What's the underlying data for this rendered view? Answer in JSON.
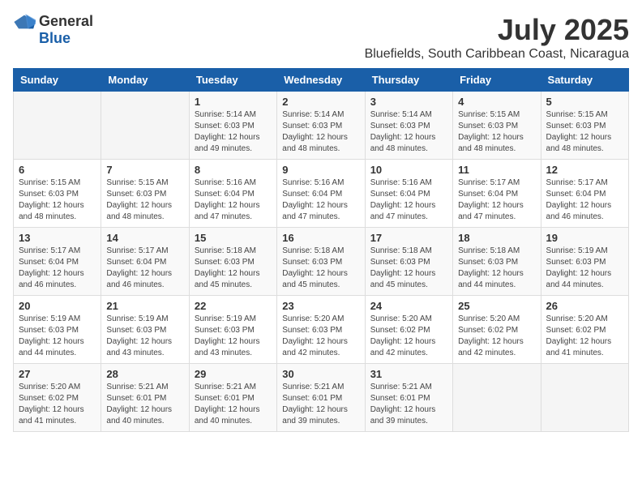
{
  "logo": {
    "general": "General",
    "blue": "Blue"
  },
  "title": "July 2025",
  "location": "Bluefields, South Caribbean Coast, Nicaragua",
  "days_header": [
    "Sunday",
    "Monday",
    "Tuesday",
    "Wednesday",
    "Thursday",
    "Friday",
    "Saturday"
  ],
  "weeks": [
    [
      {
        "day": "",
        "info": ""
      },
      {
        "day": "",
        "info": ""
      },
      {
        "day": "1",
        "info": "Sunrise: 5:14 AM\nSunset: 6:03 PM\nDaylight: 12 hours and 49 minutes."
      },
      {
        "day": "2",
        "info": "Sunrise: 5:14 AM\nSunset: 6:03 PM\nDaylight: 12 hours and 48 minutes."
      },
      {
        "day": "3",
        "info": "Sunrise: 5:14 AM\nSunset: 6:03 PM\nDaylight: 12 hours and 48 minutes."
      },
      {
        "day": "4",
        "info": "Sunrise: 5:15 AM\nSunset: 6:03 PM\nDaylight: 12 hours and 48 minutes."
      },
      {
        "day": "5",
        "info": "Sunrise: 5:15 AM\nSunset: 6:03 PM\nDaylight: 12 hours and 48 minutes."
      }
    ],
    [
      {
        "day": "6",
        "info": "Sunrise: 5:15 AM\nSunset: 6:03 PM\nDaylight: 12 hours and 48 minutes."
      },
      {
        "day": "7",
        "info": "Sunrise: 5:15 AM\nSunset: 6:03 PM\nDaylight: 12 hours and 48 minutes."
      },
      {
        "day": "8",
        "info": "Sunrise: 5:16 AM\nSunset: 6:04 PM\nDaylight: 12 hours and 47 minutes."
      },
      {
        "day": "9",
        "info": "Sunrise: 5:16 AM\nSunset: 6:04 PM\nDaylight: 12 hours and 47 minutes."
      },
      {
        "day": "10",
        "info": "Sunrise: 5:16 AM\nSunset: 6:04 PM\nDaylight: 12 hours and 47 minutes."
      },
      {
        "day": "11",
        "info": "Sunrise: 5:17 AM\nSunset: 6:04 PM\nDaylight: 12 hours and 47 minutes."
      },
      {
        "day": "12",
        "info": "Sunrise: 5:17 AM\nSunset: 6:04 PM\nDaylight: 12 hours and 46 minutes."
      }
    ],
    [
      {
        "day": "13",
        "info": "Sunrise: 5:17 AM\nSunset: 6:04 PM\nDaylight: 12 hours and 46 minutes."
      },
      {
        "day": "14",
        "info": "Sunrise: 5:17 AM\nSunset: 6:04 PM\nDaylight: 12 hours and 46 minutes."
      },
      {
        "day": "15",
        "info": "Sunrise: 5:18 AM\nSunset: 6:03 PM\nDaylight: 12 hours and 45 minutes."
      },
      {
        "day": "16",
        "info": "Sunrise: 5:18 AM\nSunset: 6:03 PM\nDaylight: 12 hours and 45 minutes."
      },
      {
        "day": "17",
        "info": "Sunrise: 5:18 AM\nSunset: 6:03 PM\nDaylight: 12 hours and 45 minutes."
      },
      {
        "day": "18",
        "info": "Sunrise: 5:18 AM\nSunset: 6:03 PM\nDaylight: 12 hours and 44 minutes."
      },
      {
        "day": "19",
        "info": "Sunrise: 5:19 AM\nSunset: 6:03 PM\nDaylight: 12 hours and 44 minutes."
      }
    ],
    [
      {
        "day": "20",
        "info": "Sunrise: 5:19 AM\nSunset: 6:03 PM\nDaylight: 12 hours and 44 minutes."
      },
      {
        "day": "21",
        "info": "Sunrise: 5:19 AM\nSunset: 6:03 PM\nDaylight: 12 hours and 43 minutes."
      },
      {
        "day": "22",
        "info": "Sunrise: 5:19 AM\nSunset: 6:03 PM\nDaylight: 12 hours and 43 minutes."
      },
      {
        "day": "23",
        "info": "Sunrise: 5:20 AM\nSunset: 6:03 PM\nDaylight: 12 hours and 42 minutes."
      },
      {
        "day": "24",
        "info": "Sunrise: 5:20 AM\nSunset: 6:02 PM\nDaylight: 12 hours and 42 minutes."
      },
      {
        "day": "25",
        "info": "Sunrise: 5:20 AM\nSunset: 6:02 PM\nDaylight: 12 hours and 42 minutes."
      },
      {
        "day": "26",
        "info": "Sunrise: 5:20 AM\nSunset: 6:02 PM\nDaylight: 12 hours and 41 minutes."
      }
    ],
    [
      {
        "day": "27",
        "info": "Sunrise: 5:20 AM\nSunset: 6:02 PM\nDaylight: 12 hours and 41 minutes."
      },
      {
        "day": "28",
        "info": "Sunrise: 5:21 AM\nSunset: 6:01 PM\nDaylight: 12 hours and 40 minutes."
      },
      {
        "day": "29",
        "info": "Sunrise: 5:21 AM\nSunset: 6:01 PM\nDaylight: 12 hours and 40 minutes."
      },
      {
        "day": "30",
        "info": "Sunrise: 5:21 AM\nSunset: 6:01 PM\nDaylight: 12 hours and 39 minutes."
      },
      {
        "day": "31",
        "info": "Sunrise: 5:21 AM\nSunset: 6:01 PM\nDaylight: 12 hours and 39 minutes."
      },
      {
        "day": "",
        "info": ""
      },
      {
        "day": "",
        "info": ""
      }
    ]
  ]
}
